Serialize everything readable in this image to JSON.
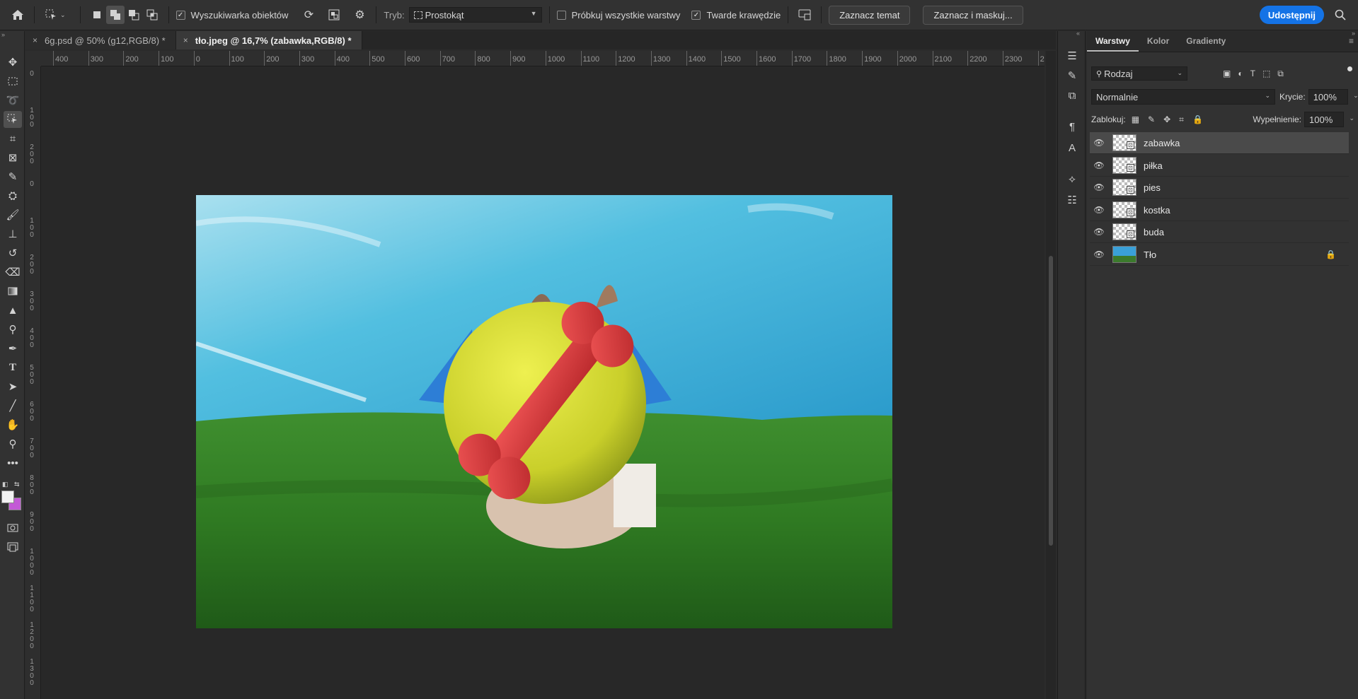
{
  "options_bar": {
    "home_icon": "home-icon",
    "object_finder_label": "Wyszukiwarka obiektów",
    "mode_label": "Tryb:",
    "mode_value": "Prostokąt",
    "sample_all_layers_label": "Próbkuj wszystkie warstwy",
    "hard_edges_label": "Twarde krawędzie",
    "select_subject_label": "Zaznacz temat",
    "select_and_mask_label": "Zaznacz i maskuj...",
    "share_label": "Udostępnij"
  },
  "tabs": [
    {
      "label": "6g.psd @ 50% (g12,RGB/8) *",
      "active": false
    },
    {
      "label": "tło.jpeg @ 16,7% (zabawka,RGB/8) *",
      "active": true
    }
  ],
  "ruler": {
    "h_ticks": [
      "400",
      "300",
      "200",
      "100",
      "0",
      "100",
      "200",
      "300",
      "400",
      "500",
      "600",
      "700",
      "800",
      "900",
      "1000",
      "1100",
      "1200",
      "1300",
      "1400",
      "1500",
      "1600",
      "1700",
      "1800",
      "1900",
      "2000",
      "2100",
      "2200",
      "2300",
      "2"
    ],
    "v_ticks": [
      "0",
      "1 0 0",
      "2 0 0",
      "0",
      "1 0 0",
      "2 0 0",
      "3 0 0",
      "4 0 0",
      "5 0 0",
      "6 0 0",
      "7 0 0",
      "8 0 0",
      "9 0 0",
      "1 0 0 0",
      "1 1 0 0",
      "1 2 0 0",
      "1 3 0 0"
    ]
  },
  "layers_panel": {
    "tabs": [
      "Warstwy",
      "Kolor",
      "Gradienty"
    ],
    "filter_label": "Rodzaj",
    "blend_mode": "Normalnie",
    "opacity_label": "Krycie:",
    "opacity_value": "100%",
    "lock_label": "Zablokuj:",
    "fill_label": "Wypełnienie:",
    "fill_value": "100%",
    "layers": [
      {
        "name": "zabawka",
        "selected": true,
        "locked": false
      },
      {
        "name": "piłka",
        "selected": false,
        "locked": false
      },
      {
        "name": "pies",
        "selected": false,
        "locked": false
      },
      {
        "name": "kostka",
        "selected": false,
        "locked": false
      },
      {
        "name": "buda",
        "selected": false,
        "locked": false
      },
      {
        "name": "Tło",
        "selected": false,
        "locked": true
      }
    ]
  },
  "colors": {
    "accent": "#1473e6",
    "background": "#2b2b2b",
    "panel": "#323232",
    "foreground_swatch": "#f2f2f2",
    "background_swatch": "#c35ad6"
  }
}
